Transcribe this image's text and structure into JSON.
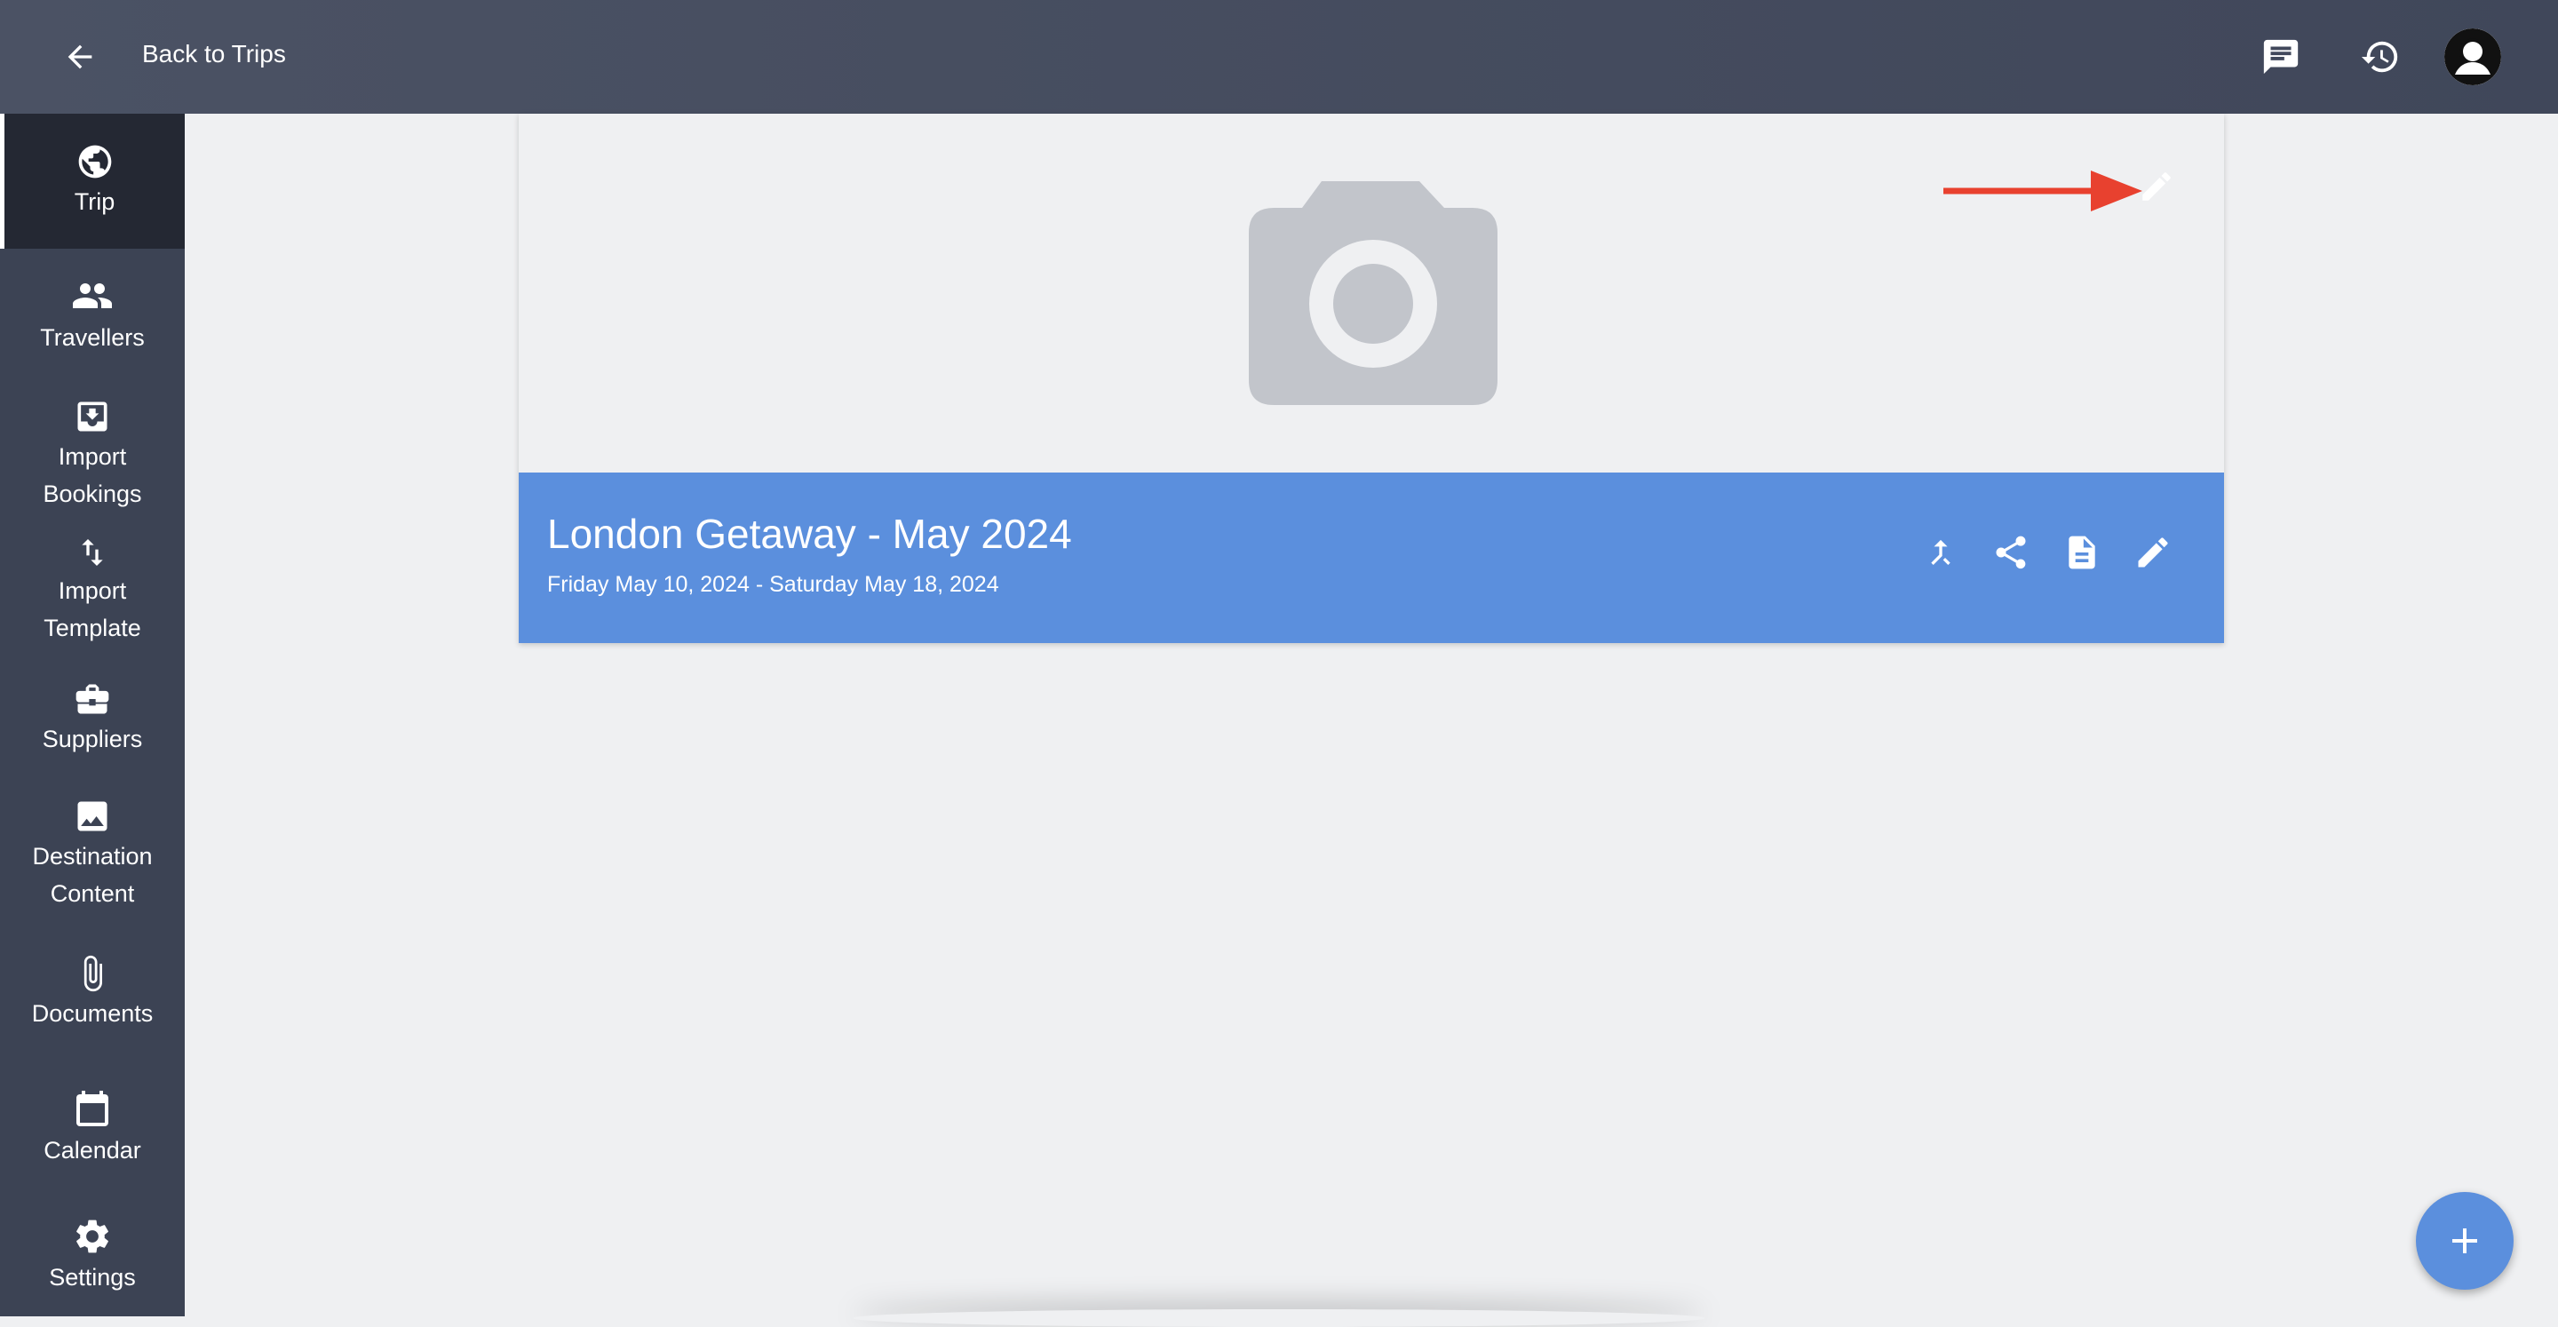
{
  "header": {
    "back_label": "Back to Trips",
    "icons": [
      "arrow-left-icon",
      "chat-icon",
      "history-icon",
      "avatar"
    ]
  },
  "sidebar": {
    "items": [
      {
        "label": "Trip",
        "icon": "globe-icon",
        "active": true
      },
      {
        "label": "Travellers",
        "icon": "people-icon"
      },
      {
        "label": "Import Bookings",
        "icon": "import-icon"
      },
      {
        "label": "Import Template",
        "icon": "swap-vertical-icon"
      },
      {
        "label": "Suppliers",
        "icon": "briefcase-icon"
      },
      {
        "label": "Destination Content",
        "icon": "image-icon"
      },
      {
        "label": "Documents",
        "icon": "paperclip-icon"
      },
      {
        "label": "Calendar",
        "icon": "calendar-icon"
      },
      {
        "label": "Settings",
        "icon": "gear-icon"
      }
    ]
  },
  "trip": {
    "title": "London Getaway - May 2024",
    "dates": "Friday May 10, 2024 - Saturday May 18, 2024",
    "actions": [
      "merge-icon",
      "share-icon",
      "document-icon",
      "pencil-icon"
    ]
  },
  "colors": {
    "topbar": "#444b5e",
    "sidebar": "#3c4354",
    "sidebar_active": "#242833",
    "banner": "#5b8fdd",
    "annotation_arrow": "#e8412f",
    "background": "#eff0f2"
  }
}
